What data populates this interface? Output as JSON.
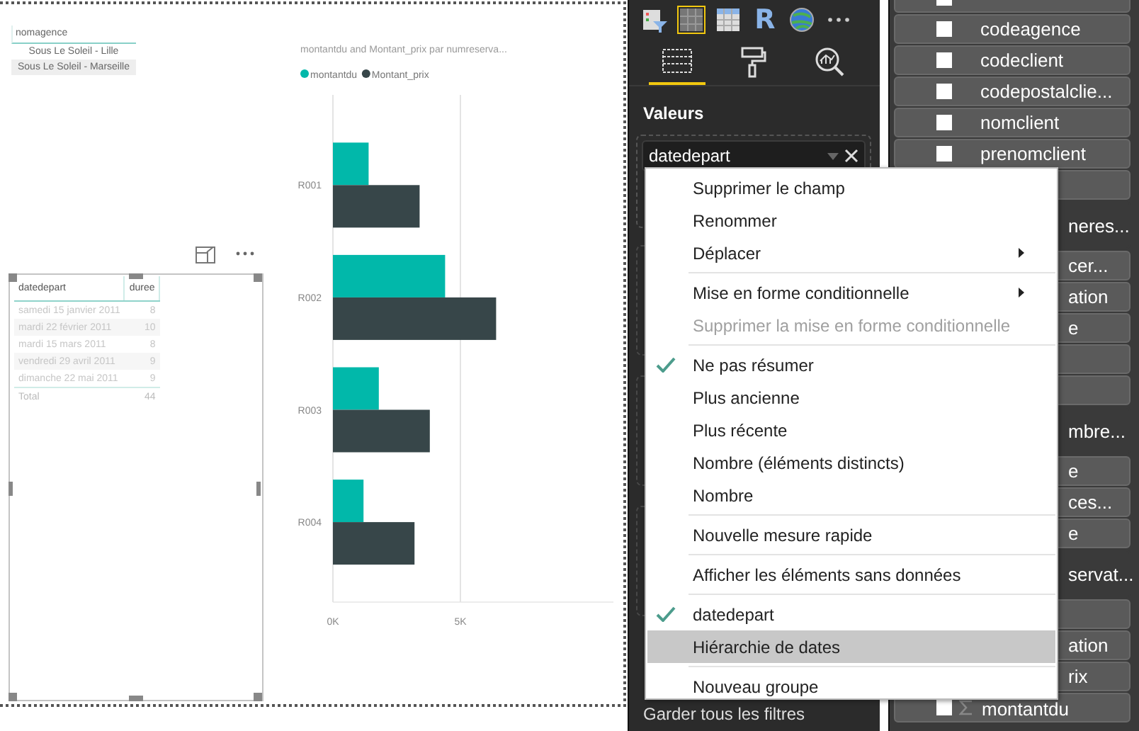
{
  "canvas": {
    "slicer": {
      "title": "nomagence",
      "items": [
        {
          "label": "Sous Le Soleil - Lille",
          "selected": false
        },
        {
          "label": "Sous Le Soleil - Marseille",
          "selected": true
        }
      ]
    },
    "table": {
      "columns": [
        "datedepart",
        "duree"
      ],
      "rows": [
        [
          "samedi 15 janvier 2011",
          "8"
        ],
        [
          "mardi 22 février 2011",
          "10"
        ],
        [
          "mardi 15 mars 2011",
          "8"
        ],
        [
          "vendredi 29 avril 2011",
          "9"
        ],
        [
          "dimanche 22 mai 2011",
          "9"
        ]
      ],
      "total": [
        "Total",
        "44"
      ]
    },
    "chart": {
      "chart_data": {
        "type": "bar",
        "orientation": "horizontal",
        "title": "montantdu and Montant_prix par numreserva...",
        "categories": [
          "R001",
          "R002",
          "R003",
          "R004"
        ],
        "series": [
          {
            "name": "montantdu",
            "color": "#01b8aa",
            "values": [
              1400,
              4400,
              1800,
              1200
            ]
          },
          {
            "name": "Montant_prix",
            "color": "#374649",
            "values": [
              3400,
              6400,
              3800,
              3200
            ]
          }
        ],
        "legend": "top",
        "xlim": [
          0,
          11000
        ],
        "xticks": [
          {
            "value": 0,
            "label": "0K"
          },
          {
            "value": 5000,
            "label": "5K"
          }
        ]
      }
    }
  },
  "visualizations": {
    "visual_types": [
      {
        "kind": "slicer",
        "selected": false
      },
      {
        "kind": "table",
        "selected": true
      },
      {
        "kind": "matrix",
        "selected": false
      },
      {
        "kind": "r",
        "label": "R",
        "selected": false
      },
      {
        "kind": "globe",
        "selected": false
      },
      {
        "kind": "more",
        "selected": false
      }
    ],
    "tabs": [
      {
        "kind": "fields",
        "selected": true
      },
      {
        "kind": "format",
        "selected": false
      },
      {
        "kind": "analytics",
        "selected": false
      }
    ],
    "section_title": "Valeurs",
    "value_field": "datedepart",
    "footer": "Garder tous les filtres"
  },
  "fields": [
    {
      "kind": "field",
      "covered": false,
      "checked": false
    },
    {
      "kind": "field",
      "label": "codeagence",
      "covered": false,
      "checked": false
    },
    {
      "kind": "field",
      "label": "codeclient",
      "covered": false,
      "checked": false
    },
    {
      "kind": "field",
      "label": "codepostalclie...",
      "covered": false,
      "checked": false
    },
    {
      "kind": "field",
      "label": "nomclient",
      "covered": false,
      "checked": false
    },
    {
      "kind": "field",
      "label": "prenomclient",
      "covered": false,
      "checked": false
    },
    {
      "kind": "field"
    },
    {
      "kind": "table",
      "label": "neres...",
      "covered": true
    },
    {
      "kind": "field",
      "label": "cer...",
      "covered": true
    },
    {
      "kind": "field",
      "label": "ation",
      "covered": true
    },
    {
      "kind": "field",
      "label": "e",
      "covered": true
    },
    {
      "kind": "field"
    },
    {
      "kind": "field"
    },
    {
      "kind": "table",
      "label": "mbre...",
      "covered": true
    },
    {
      "kind": "field",
      "label": "e",
      "covered": true
    },
    {
      "kind": "field",
      "label": "ces...",
      "covered": true
    },
    {
      "kind": "field",
      "label": "e",
      "covered": true
    },
    {
      "kind": "table",
      "label": "servat...",
      "covered": true
    },
    {
      "kind": "field"
    },
    {
      "kind": "field",
      "label": "ation",
      "covered": true
    },
    {
      "kind": "field",
      "label": "rix",
      "covered": true
    },
    {
      "kind": "field",
      "label": "montantdu",
      "covered": false,
      "checked": false,
      "measure": true
    }
  ],
  "context_menu": [
    {
      "kind": "item",
      "label": "Supprimer le champ",
      "checked": false,
      "disabled": false,
      "submenu": false,
      "selected": false
    },
    {
      "kind": "item",
      "label": "Renommer",
      "checked": false,
      "disabled": false,
      "submenu": false,
      "selected": false
    },
    {
      "kind": "item",
      "label": "Déplacer",
      "checked": false,
      "disabled": false,
      "submenu": true,
      "selected": false
    },
    {
      "kind": "separator"
    },
    {
      "kind": "item",
      "label": "Mise en forme conditionnelle",
      "checked": false,
      "disabled": false,
      "submenu": true,
      "selected": false
    },
    {
      "kind": "item",
      "label": "Supprimer la mise en forme conditionnelle",
      "checked": false,
      "disabled": true,
      "submenu": false,
      "selected": false
    },
    {
      "kind": "separator"
    },
    {
      "kind": "item",
      "label": "Ne pas résumer",
      "checked": true,
      "disabled": false,
      "submenu": false,
      "selected": false
    },
    {
      "kind": "item",
      "label": "Plus ancienne",
      "checked": false,
      "disabled": false,
      "submenu": false,
      "selected": false
    },
    {
      "kind": "item",
      "label": "Plus récente",
      "checked": false,
      "disabled": false,
      "submenu": false,
      "selected": false
    },
    {
      "kind": "item",
      "label": "Nombre (éléments distincts)",
      "checked": false,
      "disabled": false,
      "submenu": false,
      "selected": false
    },
    {
      "kind": "item",
      "label": "Nombre",
      "checked": false,
      "disabled": false,
      "submenu": false,
      "selected": false
    },
    {
      "kind": "separator"
    },
    {
      "kind": "item",
      "label": "Nouvelle mesure rapide",
      "checked": false,
      "disabled": false,
      "submenu": false,
      "selected": false
    },
    {
      "kind": "separator"
    },
    {
      "kind": "item",
      "label": "Afficher les éléments sans données",
      "checked": false,
      "disabled": false,
      "submenu": false,
      "selected": false
    },
    {
      "kind": "separator"
    },
    {
      "kind": "item",
      "label": "datedepart",
      "checked": true,
      "disabled": false,
      "submenu": false,
      "selected": false
    },
    {
      "kind": "item",
      "label": "Hiérarchie de dates",
      "checked": false,
      "disabled": false,
      "submenu": false,
      "selected": true
    },
    {
      "kind": "separator"
    },
    {
      "kind": "item",
      "label": "Nouveau groupe",
      "checked": false,
      "disabled": false,
      "submenu": false,
      "selected": false
    }
  ]
}
